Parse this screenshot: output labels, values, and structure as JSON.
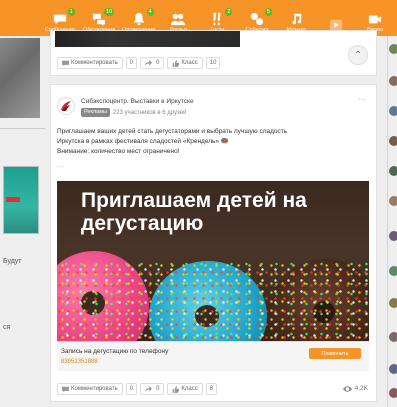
{
  "colors": {
    "accent": "#f79428",
    "badge": "#6bb321"
  },
  "topnav": {
    "items": [
      {
        "label": "Сообщения",
        "icon": "messages-icon",
        "badge": "1"
      },
      {
        "label": "Обсуждения",
        "icon": "discussions-icon",
        "badge": "10"
      },
      {
        "label": "Оповещения",
        "icon": "bell-icon",
        "badge": "4"
      },
      {
        "label": "Друзья",
        "icon": "friends-icon",
        "badge": ""
      },
      {
        "label": "Гости",
        "icon": "guests-icon",
        "badge": "2"
      },
      {
        "label": "События",
        "icon": "events-icon",
        "badge": "5"
      },
      {
        "label": "Музыка",
        "icon": "music-icon",
        "badge": ""
      },
      {
        "label": "",
        "icon": "play-icon",
        "badge": ""
      },
      {
        "label": "Видео",
        "icon": "video-icon",
        "badge": ""
      }
    ]
  },
  "left": {
    "text1": "Будут",
    "text2": "ся"
  },
  "card_top": {
    "actions": [
      {
        "label": "Комментировать",
        "count": "0"
      },
      {
        "label": "",
        "count": "0"
      },
      {
        "label": "Класс",
        "count": "10"
      }
    ]
  },
  "post": {
    "group_name": "Сибэкспоцентр. Выставки в Иркутске",
    "join_label": "Рекламы",
    "members": "223 участников в 6 друзей",
    "text_line1": "Приглашаем ваших детей стать дегустаторами и выбрать лучшую сладость",
    "text_line2": "Иркутска в рамках фестиваля сладостей «Крендель» 🍩",
    "text_line3": "Внимание: количество мест ограничено!",
    "ellipsis": "...",
    "promo_title": "Приглашаем детей на дегустацию",
    "promo_caption": "Запись на дегустацию по телефону",
    "promo_phone": "83952351888",
    "promo_button": "Позвонить",
    "actions": [
      {
        "label": "Комментировать",
        "count": "0"
      },
      {
        "label": "",
        "count": "0"
      },
      {
        "label": "Класс",
        "count": "8"
      }
    ],
    "views": "4.2K"
  }
}
